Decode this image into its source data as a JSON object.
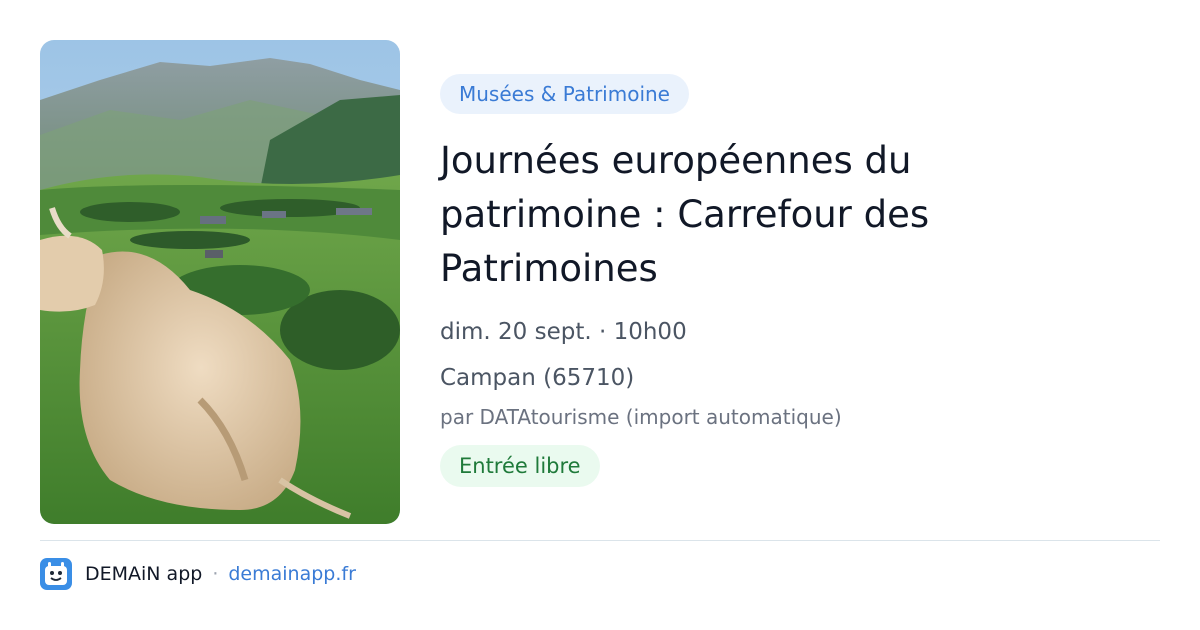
{
  "event": {
    "category": "Musées & Patrimoine",
    "title": "Journées européennes du patrimoine : Carrefour des Patrimoines",
    "datetime": "dim. 20 sept. · 10h00",
    "location": "Campan (65710)",
    "source": "par DATAtourisme (import automatique)",
    "price": "Entrée libre",
    "image": {
      "subject": "cow lying in mountain pasture",
      "icon": "photo"
    }
  },
  "footer": {
    "app_name": "DEMAiN app",
    "separator": "·",
    "domain": "demainapp.fr",
    "app_icon": "app-logo-icon"
  },
  "colors": {
    "accent": "#3a7bd5",
    "category_bg": "#eaf2fc",
    "price_bg": "#eafaef",
    "price_text": "#1f7a3a",
    "title_text": "#111827"
  }
}
